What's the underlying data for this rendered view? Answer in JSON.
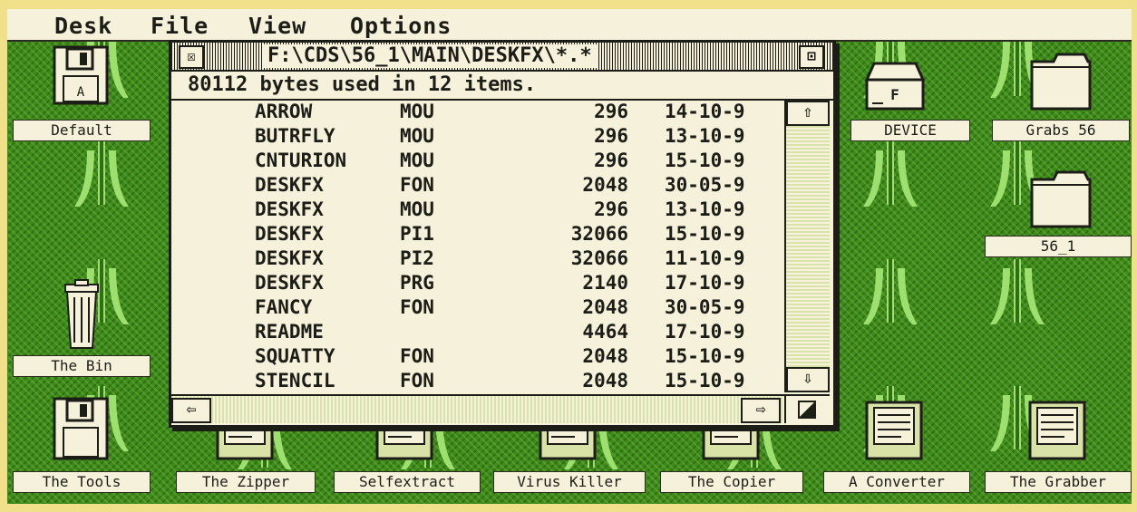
{
  "menu": [
    "Desk",
    "File",
    "View",
    "Options"
  ],
  "window": {
    "title": "F:\\CDS\\56_1\\MAIN\\DESKFX\\*.*",
    "info": "80112 bytes used in 12 items.",
    "close_glyph": "☒",
    "full_glyph": "⊡",
    "up_glyph": "⇧",
    "down_glyph": "⇩",
    "left_glyph": "⇦",
    "right_glyph": "⇨",
    "files": [
      {
        "name": "ARROW",
        "ext": "MOU",
        "size": "296",
        "date": "14-10-9"
      },
      {
        "name": "BUTRFLY",
        "ext": "MOU",
        "size": "296",
        "date": "13-10-9"
      },
      {
        "name": "CNTURION",
        "ext": "MOU",
        "size": "296",
        "date": "15-10-9"
      },
      {
        "name": "DESKFX",
        "ext": "FON",
        "size": "2048",
        "date": "30-05-9"
      },
      {
        "name": "DESKFX",
        "ext": "MOU",
        "size": "296",
        "date": "13-10-9"
      },
      {
        "name": "DESKFX",
        "ext": "PI1",
        "size": "32066",
        "date": "15-10-9"
      },
      {
        "name": "DESKFX",
        "ext": "PI2",
        "size": "32066",
        "date": "11-10-9"
      },
      {
        "name": "DESKFX",
        "ext": "PRG",
        "size": "2140",
        "date": "17-10-9"
      },
      {
        "name": "FANCY",
        "ext": "FON",
        "size": "2048",
        "date": "30-05-9"
      },
      {
        "name": "README",
        "ext": "",
        "size": "4464",
        "date": "17-10-9"
      },
      {
        "name": "SQUATTY",
        "ext": "FON",
        "size": "2048",
        "date": "15-10-9"
      },
      {
        "name": "STENCIL",
        "ext": "FON",
        "size": "2048",
        "date": "15-10-9"
      }
    ]
  },
  "desktop_icons": {
    "default": "Default",
    "the_bin": "The Bin",
    "the_tools": "The Tools",
    "device": "DEVICE",
    "grabs56": "Grabs 56",
    "folder56_1": "56_1",
    "the_zipper": "The Zipper",
    "selfextract": "Selfextract",
    "virus_killer": "Virus Killer",
    "the_copier": "The Copier",
    "a_converter": "A Converter",
    "the_grabber": "The Grabber",
    "drive_letter_f": "F",
    "disk_letter_a": "A"
  }
}
